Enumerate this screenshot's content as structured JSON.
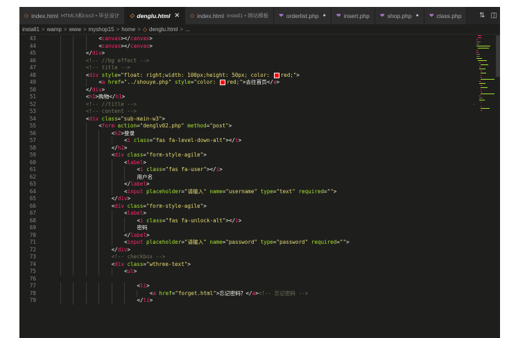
{
  "tabs": [
    {
      "icon": "html-file-icon",
      "name": "index.html",
      "desc": "HTML5和css3 • 毕业设计",
      "active": false,
      "close": "",
      "modified": false
    },
    {
      "icon": "html-file-icon",
      "name": "denglu.html",
      "desc": "",
      "active": true,
      "close": "✕",
      "modified": false
    },
    {
      "icon": "html-file-icon",
      "name": "index.html",
      "desc": "install1 • 网站模板",
      "active": false,
      "close": "",
      "modified": false
    },
    {
      "icon": "php-file-icon",
      "name": "orderlist.php",
      "desc": "",
      "active": false,
      "close": "",
      "modified": true
    },
    {
      "icon": "php-file-icon",
      "name": "insert.php",
      "desc": "",
      "active": false,
      "close": "",
      "modified": false
    },
    {
      "icon": "php-file-icon",
      "name": "shop.php",
      "desc": "",
      "active": false,
      "close": "",
      "modified": true
    },
    {
      "icon": "php-file-icon",
      "name": "class.php",
      "desc": "",
      "active": false,
      "close": "",
      "modified": false
    }
  ],
  "tab_actions": {
    "compare": "⇅",
    "split": "◫"
  },
  "breadcrumb": {
    "segments": [
      "install1",
      "wamp",
      "www",
      "myshop15",
      "home"
    ],
    "file": "denglu.html",
    "tail": "...",
    "separator": ">"
  },
  "colors": {
    "tag": "#f92672",
    "attr": "#a6e22e",
    "string": "#e6db74",
    "text": "#f8f8f2",
    "comment": "#75715e",
    "punct": "#f8f8f2",
    "swatch_red": "#ff0000"
  },
  "code_lines": [
    {
      "n": "43",
      "indent": 6,
      "tokens": [
        [
          "p",
          "<"
        ],
        [
          "t",
          "canvas"
        ],
        [
          "p",
          "></"
        ],
        [
          "t",
          "canvas"
        ],
        [
          "p",
          ">"
        ]
      ]
    },
    {
      "n": "44",
      "indent": 6,
      "tokens": [
        [
          "p",
          "<"
        ],
        [
          "t",
          "canvas"
        ],
        [
          "p",
          "></"
        ],
        [
          "t",
          "canvas"
        ],
        [
          "p",
          ">"
        ]
      ]
    },
    {
      "n": "45",
      "indent": 4,
      "tokens": [
        [
          "p",
          "</"
        ],
        [
          "t",
          "div"
        ],
        [
          "p",
          ">"
        ]
      ]
    },
    {
      "n": "46",
      "indent": 4,
      "tokens": [
        [
          "c",
          "<!-- //bg effect -->"
        ]
      ]
    },
    {
      "n": "47",
      "indent": 4,
      "tokens": [
        [
          "c",
          "<!-- title -->"
        ]
      ]
    },
    {
      "n": "48",
      "indent": 4,
      "tokens": [
        [
          "p",
          "<"
        ],
        [
          "t",
          "div"
        ],
        [
          "p",
          " "
        ],
        [
          "a",
          "style"
        ],
        [
          "p",
          "="
        ],
        [
          "s",
          "\"float: right;width: 100px;height: 50px; color: "
        ],
        [
          "sw",
          ""
        ],
        [
          "s",
          "red;\""
        ],
        [
          "p",
          ">"
        ]
      ]
    },
    {
      "n": "49",
      "indent": 6,
      "tokens": [
        [
          "p",
          "<"
        ],
        [
          "t",
          "a"
        ],
        [
          "p",
          " "
        ],
        [
          "a",
          "href"
        ],
        [
          "p",
          "="
        ],
        [
          "s",
          "\"../shouye.php\""
        ],
        [
          "p",
          " "
        ],
        [
          "a",
          "style"
        ],
        [
          "p",
          "="
        ],
        [
          "s",
          "\"color: "
        ],
        [
          "sw",
          ""
        ],
        [
          "s",
          "red;\""
        ],
        [
          "p",
          ">"
        ],
        [
          "x",
          "去往首页"
        ],
        [
          "p",
          "</"
        ],
        [
          "t",
          "a"
        ],
        [
          "p",
          ">"
        ]
      ]
    },
    {
      "n": "50",
      "indent": 4,
      "tokens": [
        [
          "p",
          "</"
        ],
        [
          "t",
          "div"
        ],
        [
          "p",
          ">"
        ]
      ]
    },
    {
      "n": "51",
      "indent": 4,
      "tokens": [
        [
          "p",
          "<"
        ],
        [
          "t",
          "h1"
        ],
        [
          "p",
          ">"
        ],
        [
          "x",
          "购物"
        ],
        [
          "p",
          "</"
        ],
        [
          "t",
          "h1"
        ],
        [
          "p",
          ">"
        ]
      ]
    },
    {
      "n": "52",
      "indent": 4,
      "tokens": [
        [
          "c",
          "<!-- //title -->"
        ]
      ]
    },
    {
      "n": "53",
      "indent": 4,
      "tokens": [
        [
          "c",
          "<!-- content -->"
        ]
      ]
    },
    {
      "n": "54",
      "indent": 4,
      "tokens": [
        [
          "p",
          "<"
        ],
        [
          "t",
          "div"
        ],
        [
          "p",
          " "
        ],
        [
          "a",
          "class"
        ],
        [
          "p",
          "="
        ],
        [
          "s",
          "\"sub-main-w3\""
        ],
        [
          "p",
          ">"
        ]
      ]
    },
    {
      "n": "55",
      "indent": 6,
      "tokens": [
        [
          "p",
          "<"
        ],
        [
          "t",
          "form"
        ],
        [
          "p",
          " "
        ],
        [
          "a",
          "action"
        ],
        [
          "p",
          "="
        ],
        [
          "s",
          "\"denglv02.php\""
        ],
        [
          "p",
          " "
        ],
        [
          "a",
          "method"
        ],
        [
          "p",
          "="
        ],
        [
          "s",
          "\"post\""
        ],
        [
          "p",
          ">"
        ]
      ]
    },
    {
      "n": "56",
      "indent": 8,
      "tokens": [
        [
          "p",
          "<"
        ],
        [
          "t",
          "h2"
        ],
        [
          "p",
          ">"
        ],
        [
          "x",
          "登录"
        ]
      ]
    },
    {
      "n": "57",
      "indent": 10,
      "tokens": [
        [
          "p",
          "<"
        ],
        [
          "t",
          "i"
        ],
        [
          "p",
          " "
        ],
        [
          "a",
          "class"
        ],
        [
          "p",
          "="
        ],
        [
          "s",
          "\"fas fa-level-down-alt\""
        ],
        [
          "p",
          "></"
        ],
        [
          "t",
          "i"
        ],
        [
          "p",
          ">"
        ]
      ]
    },
    {
      "n": "58",
      "indent": 8,
      "tokens": [
        [
          "p",
          "</"
        ],
        [
          "t",
          "h2"
        ],
        [
          "p",
          ">"
        ]
      ]
    },
    {
      "n": "59",
      "indent": 8,
      "tokens": [
        [
          "p",
          "<"
        ],
        [
          "t",
          "div"
        ],
        [
          "p",
          " "
        ],
        [
          "a",
          "class"
        ],
        [
          "p",
          "="
        ],
        [
          "s",
          "\"form-style-agile\""
        ],
        [
          "p",
          ">"
        ]
      ]
    },
    {
      "n": "60",
      "indent": 10,
      "tokens": [
        [
          "p",
          "<"
        ],
        [
          "t",
          "label"
        ],
        [
          "p",
          ">"
        ]
      ]
    },
    {
      "n": "61",
      "indent": 12,
      "tokens": [
        [
          "p",
          "<"
        ],
        [
          "t",
          "i"
        ],
        [
          "p",
          " "
        ],
        [
          "a",
          "class"
        ],
        [
          "p",
          "="
        ],
        [
          "s",
          "\"fas fa-user\""
        ],
        [
          "p",
          "></"
        ],
        [
          "t",
          "i"
        ],
        [
          "p",
          ">"
        ]
      ]
    },
    {
      "n": "62",
      "indent": 12,
      "tokens": [
        [
          "x",
          "用户名"
        ]
      ]
    },
    {
      "n": "63",
      "indent": 10,
      "tokens": [
        [
          "p",
          "</"
        ],
        [
          "t",
          "label"
        ],
        [
          "p",
          ">"
        ]
      ]
    },
    {
      "n": "64",
      "indent": 10,
      "tokens": [
        [
          "p",
          "<"
        ],
        [
          "t",
          "input"
        ],
        [
          "p",
          " "
        ],
        [
          "a",
          "placeholder"
        ],
        [
          "p",
          "="
        ],
        [
          "s",
          "\"请输入\""
        ],
        [
          "p",
          " "
        ],
        [
          "a",
          "name"
        ],
        [
          "p",
          "="
        ],
        [
          "s",
          "\"username\""
        ],
        [
          "p",
          " "
        ],
        [
          "a",
          "type"
        ],
        [
          "p",
          "="
        ],
        [
          "s",
          "\"text\""
        ],
        [
          "p",
          " "
        ],
        [
          "a",
          "required"
        ],
        [
          "p",
          "="
        ],
        [
          "s",
          "\"\""
        ],
        [
          "p",
          ">"
        ]
      ]
    },
    {
      "n": "65",
      "indent": 8,
      "tokens": [
        [
          "p",
          "</"
        ],
        [
          "t",
          "div"
        ],
        [
          "p",
          ">"
        ]
      ]
    },
    {
      "n": "66",
      "indent": 8,
      "tokens": [
        [
          "p",
          "<"
        ],
        [
          "t",
          "div"
        ],
        [
          "p",
          " "
        ],
        [
          "a",
          "class"
        ],
        [
          "p",
          "="
        ],
        [
          "s",
          "\"form-style-agile\""
        ],
        [
          "p",
          ">"
        ]
      ]
    },
    {
      "n": "67",
      "indent": 10,
      "tokens": [
        [
          "p",
          "<"
        ],
        [
          "t",
          "label"
        ],
        [
          "p",
          ">"
        ]
      ]
    },
    {
      "n": "68",
      "indent": 12,
      "tokens": [
        [
          "p",
          "<"
        ],
        [
          "t",
          "i"
        ],
        [
          "p",
          " "
        ],
        [
          "a",
          "class"
        ],
        [
          "p",
          "="
        ],
        [
          "s",
          "\"fas fa-unlock-alt\""
        ],
        [
          "p",
          "></"
        ],
        [
          "t",
          "i"
        ],
        [
          "p",
          ">"
        ]
      ]
    },
    {
      "n": "69",
      "indent": 12,
      "tokens": [
        [
          "x",
          "密码"
        ]
      ]
    },
    {
      "n": "70",
      "indent": 10,
      "tokens": [
        [
          "p",
          "</"
        ],
        [
          "t",
          "label"
        ],
        [
          "p",
          ">"
        ]
      ]
    },
    {
      "n": "71",
      "indent": 10,
      "tokens": [
        [
          "p",
          "<"
        ],
        [
          "t",
          "input"
        ],
        [
          "p",
          " "
        ],
        [
          "a",
          "placeholder"
        ],
        [
          "p",
          "="
        ],
        [
          "s",
          "\"请输入\""
        ],
        [
          "p",
          " "
        ],
        [
          "a",
          "name"
        ],
        [
          "p",
          "="
        ],
        [
          "s",
          "\"password\""
        ],
        [
          "p",
          " "
        ],
        [
          "a",
          "type"
        ],
        [
          "p",
          "="
        ],
        [
          "s",
          "\"password\""
        ],
        [
          "p",
          " "
        ],
        [
          "a",
          "required"
        ],
        [
          "p",
          "="
        ],
        [
          "s",
          "\"\""
        ],
        [
          "p",
          ">"
        ]
      ]
    },
    {
      "n": "72",
      "indent": 8,
      "tokens": [
        [
          "p",
          "</"
        ],
        [
          "t",
          "div"
        ],
        [
          "p",
          ">"
        ]
      ]
    },
    {
      "n": "73",
      "indent": 8,
      "tokens": [
        [
          "c",
          "<!-- checkbox -->"
        ]
      ]
    },
    {
      "n": "74",
      "indent": 8,
      "tokens": [
        [
          "p",
          "<"
        ],
        [
          "t",
          "div"
        ],
        [
          "p",
          " "
        ],
        [
          "a",
          "class"
        ],
        [
          "p",
          "="
        ],
        [
          "s",
          "\"wthree-text\""
        ],
        [
          "p",
          ">"
        ]
      ]
    },
    {
      "n": "75",
      "indent": 10,
      "tokens": [
        [
          "p",
          "<"
        ],
        [
          "t",
          "ul"
        ],
        [
          "p",
          ">"
        ]
      ]
    },
    {
      "n": "76",
      "indent": 0,
      "tokens": []
    },
    {
      "n": "77",
      "indent": 12,
      "tokens": [
        [
          "p",
          "<"
        ],
        [
          "t",
          "li"
        ],
        [
          "p",
          ">"
        ]
      ]
    },
    {
      "n": "78",
      "indent": 14,
      "tokens": [
        [
          "p",
          "<"
        ],
        [
          "t",
          "a"
        ],
        [
          "p",
          " "
        ],
        [
          "a",
          "href"
        ],
        [
          "p",
          "="
        ],
        [
          "s",
          "\"forget.html\""
        ],
        [
          "p",
          ">"
        ],
        [
          "x",
          "忘记密码？"
        ],
        [
          "p",
          "</"
        ],
        [
          "t",
          "a"
        ],
        [
          "p",
          ">"
        ],
        [
          "c",
          "<!-- 忘记密码 -->"
        ]
      ]
    },
    {
      "n": "79",
      "indent": 12,
      "tokens": [
        [
          "p",
          "</"
        ],
        [
          "t",
          "li"
        ],
        [
          "p",
          ">"
        ]
      ]
    }
  ]
}
